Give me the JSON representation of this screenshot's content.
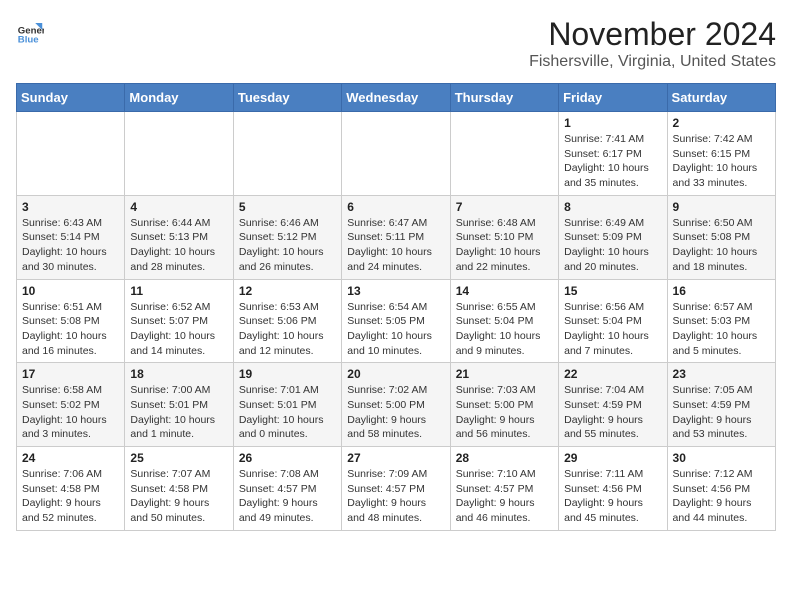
{
  "header": {
    "logo_line1": "General",
    "logo_line2": "Blue",
    "title": "November 2024",
    "subtitle": "Fishersville, Virginia, United States"
  },
  "days_of_week": [
    "Sunday",
    "Monday",
    "Tuesday",
    "Wednesday",
    "Thursday",
    "Friday",
    "Saturday"
  ],
  "weeks": [
    [
      {
        "day": "",
        "info": ""
      },
      {
        "day": "",
        "info": ""
      },
      {
        "day": "",
        "info": ""
      },
      {
        "day": "",
        "info": ""
      },
      {
        "day": "",
        "info": ""
      },
      {
        "day": "1",
        "info": "Sunrise: 7:41 AM\nSunset: 6:17 PM\nDaylight: 10 hours\nand 35 minutes."
      },
      {
        "day": "2",
        "info": "Sunrise: 7:42 AM\nSunset: 6:15 PM\nDaylight: 10 hours\nand 33 minutes."
      }
    ],
    [
      {
        "day": "3",
        "info": "Sunrise: 6:43 AM\nSunset: 5:14 PM\nDaylight: 10 hours\nand 30 minutes."
      },
      {
        "day": "4",
        "info": "Sunrise: 6:44 AM\nSunset: 5:13 PM\nDaylight: 10 hours\nand 28 minutes."
      },
      {
        "day": "5",
        "info": "Sunrise: 6:46 AM\nSunset: 5:12 PM\nDaylight: 10 hours\nand 26 minutes."
      },
      {
        "day": "6",
        "info": "Sunrise: 6:47 AM\nSunset: 5:11 PM\nDaylight: 10 hours\nand 24 minutes."
      },
      {
        "day": "7",
        "info": "Sunrise: 6:48 AM\nSunset: 5:10 PM\nDaylight: 10 hours\nand 22 minutes."
      },
      {
        "day": "8",
        "info": "Sunrise: 6:49 AM\nSunset: 5:09 PM\nDaylight: 10 hours\nand 20 minutes."
      },
      {
        "day": "9",
        "info": "Sunrise: 6:50 AM\nSunset: 5:08 PM\nDaylight: 10 hours\nand 18 minutes."
      }
    ],
    [
      {
        "day": "10",
        "info": "Sunrise: 6:51 AM\nSunset: 5:08 PM\nDaylight: 10 hours\nand 16 minutes."
      },
      {
        "day": "11",
        "info": "Sunrise: 6:52 AM\nSunset: 5:07 PM\nDaylight: 10 hours\nand 14 minutes."
      },
      {
        "day": "12",
        "info": "Sunrise: 6:53 AM\nSunset: 5:06 PM\nDaylight: 10 hours\nand 12 minutes."
      },
      {
        "day": "13",
        "info": "Sunrise: 6:54 AM\nSunset: 5:05 PM\nDaylight: 10 hours\nand 10 minutes."
      },
      {
        "day": "14",
        "info": "Sunrise: 6:55 AM\nSunset: 5:04 PM\nDaylight: 10 hours\nand 9 minutes."
      },
      {
        "day": "15",
        "info": "Sunrise: 6:56 AM\nSunset: 5:04 PM\nDaylight: 10 hours\nand 7 minutes."
      },
      {
        "day": "16",
        "info": "Sunrise: 6:57 AM\nSunset: 5:03 PM\nDaylight: 10 hours\nand 5 minutes."
      }
    ],
    [
      {
        "day": "17",
        "info": "Sunrise: 6:58 AM\nSunset: 5:02 PM\nDaylight: 10 hours\nand 3 minutes."
      },
      {
        "day": "18",
        "info": "Sunrise: 7:00 AM\nSunset: 5:01 PM\nDaylight: 10 hours\nand 1 minute."
      },
      {
        "day": "19",
        "info": "Sunrise: 7:01 AM\nSunset: 5:01 PM\nDaylight: 10 hours\nand 0 minutes."
      },
      {
        "day": "20",
        "info": "Sunrise: 7:02 AM\nSunset: 5:00 PM\nDaylight: 9 hours\nand 58 minutes."
      },
      {
        "day": "21",
        "info": "Sunrise: 7:03 AM\nSunset: 5:00 PM\nDaylight: 9 hours\nand 56 minutes."
      },
      {
        "day": "22",
        "info": "Sunrise: 7:04 AM\nSunset: 4:59 PM\nDaylight: 9 hours\nand 55 minutes."
      },
      {
        "day": "23",
        "info": "Sunrise: 7:05 AM\nSunset: 4:59 PM\nDaylight: 9 hours\nand 53 minutes."
      }
    ],
    [
      {
        "day": "24",
        "info": "Sunrise: 7:06 AM\nSunset: 4:58 PM\nDaylight: 9 hours\nand 52 minutes."
      },
      {
        "day": "25",
        "info": "Sunrise: 7:07 AM\nSunset: 4:58 PM\nDaylight: 9 hours\nand 50 minutes."
      },
      {
        "day": "26",
        "info": "Sunrise: 7:08 AM\nSunset: 4:57 PM\nDaylight: 9 hours\nand 49 minutes."
      },
      {
        "day": "27",
        "info": "Sunrise: 7:09 AM\nSunset: 4:57 PM\nDaylight: 9 hours\nand 48 minutes."
      },
      {
        "day": "28",
        "info": "Sunrise: 7:10 AM\nSunset: 4:57 PM\nDaylight: 9 hours\nand 46 minutes."
      },
      {
        "day": "29",
        "info": "Sunrise: 7:11 AM\nSunset: 4:56 PM\nDaylight: 9 hours\nand 45 minutes."
      },
      {
        "day": "30",
        "info": "Sunrise: 7:12 AM\nSunset: 4:56 PM\nDaylight: 9 hours\nand 44 minutes."
      }
    ]
  ]
}
